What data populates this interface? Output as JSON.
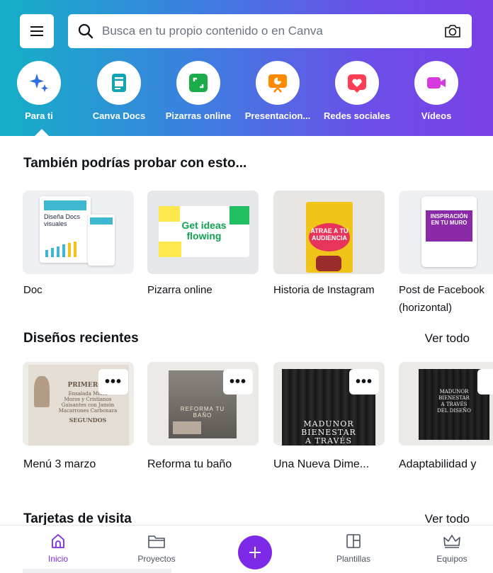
{
  "header": {
    "search": {
      "placeholder": "Busca en tu propio contenido o en Canva"
    },
    "categories": [
      {
        "label": "Para ti",
        "icon": "sparkle-icon",
        "color": "#2f6fe0"
      },
      {
        "label": "Canva Docs",
        "icon": "doc-icon",
        "color": "#13a3b5"
      },
      {
        "label": "Pizarras online",
        "icon": "whiteboard-icon",
        "color": "#1aab4b"
      },
      {
        "label": "Presentacion...",
        "icon": "presentation-icon",
        "color": "#ff8a00"
      },
      {
        "label": "Redes sociales",
        "icon": "heart-icon",
        "color": "#ff3d55"
      },
      {
        "label": "Vídeos",
        "icon": "video-icon",
        "color": "#d63adf"
      }
    ]
  },
  "suggestions": {
    "title": "También podrías probar con esto...",
    "items": [
      {
        "caption": "Doc",
        "thumb_text": "Diseña Docs visuales"
      },
      {
        "caption": "Pizarra online",
        "thumb_text": "Get ideas flowing"
      },
      {
        "caption": "Historia de Instagram",
        "thumb_text": "ATRAE A TU AUDIENCIA"
      },
      {
        "caption": "Post de Facebook",
        "caption2": "(horizontal)",
        "thumb_text": "INSPIRACIÓN EN TU MURO"
      }
    ]
  },
  "recent": {
    "title": "Diseños recientes",
    "see_all": "Ver todo",
    "more_label": "•••",
    "items": [
      {
        "caption": "Menú 3 marzo",
        "thumb_lines": [
          "PRIMEROS",
          "Ensalada Mixta",
          "Moros y Cristianos",
          "Guisantes con Jamón",
          "Macarrones Carbonara",
          "SEGUNDOS"
        ]
      },
      {
        "caption": "Reforma tu baño",
        "thumb_text": "REFORMA TU BAÑO"
      },
      {
        "caption": "Una Nueva Dime...",
        "thumb_lines": [
          "MADUNOR",
          "BIENESTAR",
          "A TRAVÉS"
        ]
      },
      {
        "caption": "Adaptabilidad y",
        "thumb_lines": [
          "MADUNOR",
          "BIENESTAR",
          "A TRAVÉS",
          "DEL DISEÑO"
        ]
      }
    ]
  },
  "business_cards": {
    "title": "Tarjetas de visita",
    "see_all": "Ver todo"
  },
  "bottom_nav": {
    "items": [
      {
        "label": "Inicio",
        "icon": "home-icon",
        "active": true
      },
      {
        "label": "Proyectos",
        "icon": "folder-icon",
        "active": false
      },
      {
        "label": "Plantillas",
        "icon": "templates-icon",
        "active": false
      },
      {
        "label": "Equipos",
        "icon": "crown-icon",
        "active": false
      }
    ],
    "accent": "#7d2ae8"
  }
}
